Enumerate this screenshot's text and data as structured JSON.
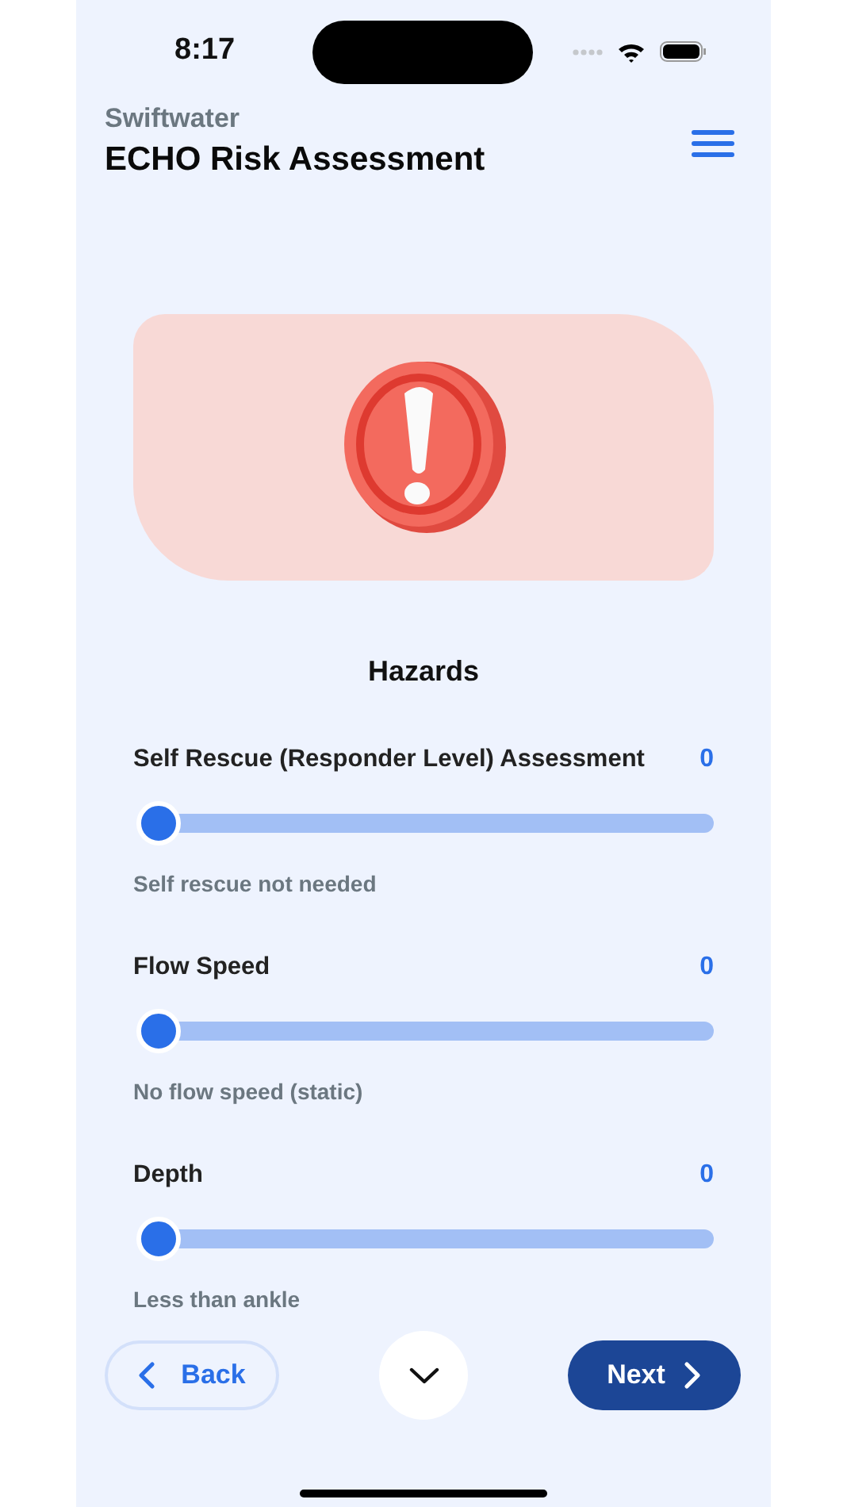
{
  "status_bar": {
    "time": "8:17"
  },
  "header": {
    "subtitle": "Swiftwater",
    "title": "ECHO Risk Assessment"
  },
  "section_title": "Hazards",
  "questions": [
    {
      "label": "Self Rescue (Responder Level) Assessment",
      "value": "0",
      "level": 0,
      "description": "Self rescue not needed"
    },
    {
      "label": "Flow Speed",
      "value": "0",
      "level": 0,
      "description": "No flow speed (static)"
    },
    {
      "label": "Depth",
      "value": "0",
      "level": 0,
      "description": "Less than ankle"
    }
  ],
  "footer": {
    "back": "Back",
    "next": "Next"
  }
}
